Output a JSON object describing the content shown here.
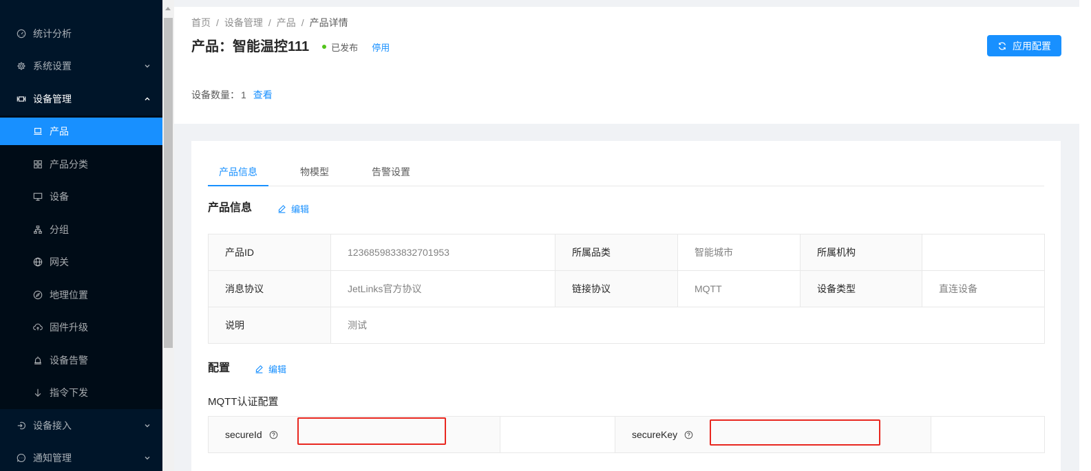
{
  "colors": {
    "sidebar_bg": "#001529",
    "submenu_bg": "#000c17",
    "primary": "#1890ff",
    "success": "#52c41a",
    "annotation_red": "#e8261e",
    "page_bg": "#f0f2f5"
  },
  "sidebar": {
    "menu": [
      {
        "label": "统计分析",
        "icon": "dashboard-icon"
      },
      {
        "label": "系统设置",
        "icon": "setting-icon",
        "expanded": false
      },
      {
        "label": "设备管理",
        "icon": "device-management-icon",
        "expanded": true,
        "children": [
          {
            "label": "产品",
            "icon": "laptop-icon",
            "selected": true
          },
          {
            "label": "产品分类",
            "icon": "appstore-icon"
          },
          {
            "label": "设备",
            "icon": "desktop-icon"
          },
          {
            "label": "分组",
            "icon": "cluster-icon"
          },
          {
            "label": "网关",
            "icon": "global-icon"
          },
          {
            "label": "地理位置",
            "icon": "compass-icon"
          },
          {
            "label": "固件升级",
            "icon": "cloud-upload-icon"
          },
          {
            "label": "设备告警",
            "icon": "alert-icon"
          },
          {
            "label": "指令下发",
            "icon": "arrow-down-icon"
          }
        ]
      },
      {
        "label": "设备接入",
        "icon": "login-icon",
        "expanded": false
      },
      {
        "label": "通知管理",
        "icon": "message-icon",
        "expanded": false
      }
    ]
  },
  "breadcrumb": {
    "separator": "/",
    "items": [
      "首页",
      "设备管理",
      "产品",
      "产品详情"
    ]
  },
  "page_header": {
    "title": "产品：智能温控111",
    "status": "已发布",
    "status_color": "#52c41a",
    "disable_link": "停用",
    "apply_button": "应用配置",
    "apply_icon": "sync-icon",
    "device_count_label": "设备数量：",
    "device_count": "1",
    "view_link": "查看"
  },
  "tabs": [
    {
      "label": "产品信息",
      "active": true
    },
    {
      "label": "物模型",
      "active": false
    },
    {
      "label": "告警设置",
      "active": false
    }
  ],
  "product_info": {
    "heading": "产品信息",
    "edit_label": "编辑",
    "rows": [
      [
        {
          "label": "产品ID",
          "value": "1236859833832701953"
        },
        {
          "label": "所属品类",
          "value": "智能城市"
        },
        {
          "label": "所属机构"
        }
      ],
      [
        {
          "label": "消息协议",
          "value": "JetLinks官方协议"
        },
        {
          "label": "链接协议",
          "value": "MQTT"
        },
        {
          "label": "设备类型",
          "value": "直连设备"
        }
      ],
      [
        {
          "label": "说明",
          "value": "测试"
        }
      ]
    ]
  },
  "config": {
    "heading": "配置",
    "edit_label": "编辑",
    "mqtt": {
      "title": "MQTT认证配置",
      "fields": [
        {
          "label": "secureId",
          "help_icon": "question-circle-icon"
        },
        {
          "label": "secureKey",
          "help_icon": "question-circle-icon"
        }
      ]
    }
  }
}
